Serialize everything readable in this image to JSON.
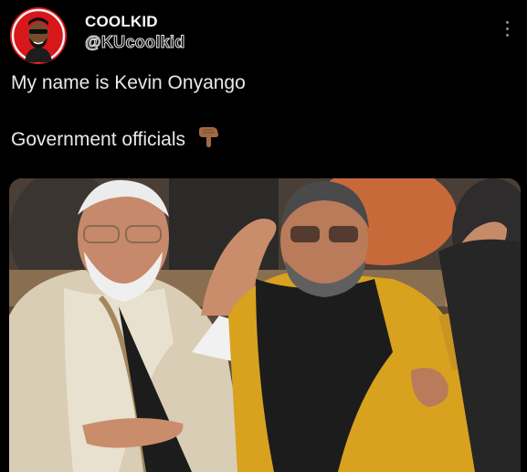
{
  "tweet": {
    "display_name": "COOLKID",
    "handle": "@KUcoolkid",
    "text_line1": "My name is Kevin Onyango",
    "text_line2": "Government officials",
    "emoji_icon": "backhand-index-pointing-down-icon"
  },
  "colors": {
    "background": "#000000",
    "text": "#e7e9ea",
    "avatar_bg": "#d8171b"
  }
}
